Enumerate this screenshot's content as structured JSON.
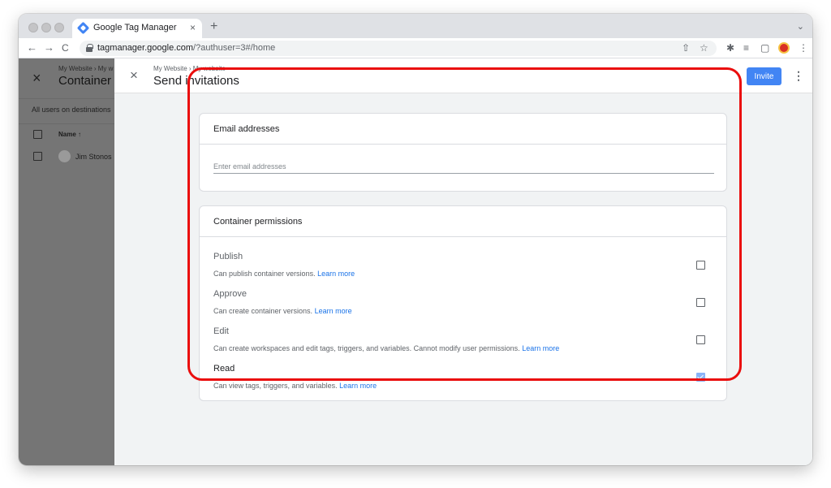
{
  "browser": {
    "tab_title": "Google Tag Manager",
    "tab_close": "×",
    "new_tab": "+",
    "tabs_menu": "⌄",
    "url_host": "tagmanager.google.com",
    "url_path": "/?authuser=3#/home",
    "back": "←",
    "forward": "→",
    "reload": "C",
    "share_icon": "⇧",
    "star_icon": "☆",
    "extensions_icon": "✱",
    "reading_list_icon": "≡",
    "sidepanel_icon": "▢",
    "menu_icon": "⋮"
  },
  "background_panel": {
    "close": "×",
    "breadcrumb": "My Website › My w",
    "title": "Container",
    "subtitle": "All users on destinations",
    "name_header": "Name ↑",
    "user": "Jim Stonos"
  },
  "dialog": {
    "close": "×",
    "breadcrumb": "My Website › My website",
    "title": "Send invitations",
    "invite_label": "Invite",
    "more": "⋮",
    "email_section": {
      "title": "Email addresses",
      "placeholder": "Enter email addresses",
      "value": ""
    },
    "permissions_section": {
      "title": "Container permissions",
      "items": [
        {
          "name": "Publish",
          "description": "Can publish container versions.",
          "link": "Learn more",
          "checked": false
        },
        {
          "name": "Approve",
          "description": "Can create container versions.",
          "link": "Learn more",
          "checked": false
        },
        {
          "name": "Edit",
          "description": "Can create workspaces and edit tags, triggers, and variables. Cannot modify user permissions.",
          "link": "Learn more",
          "checked": false
        },
        {
          "name": "Read",
          "description": "Can view tags, triggers, and variables.",
          "link": "Learn more",
          "checked": true
        }
      ]
    }
  },
  "colors": {
    "accent": "#4285f4",
    "link": "#1a73e8",
    "highlight": "#ea0d0d"
  }
}
